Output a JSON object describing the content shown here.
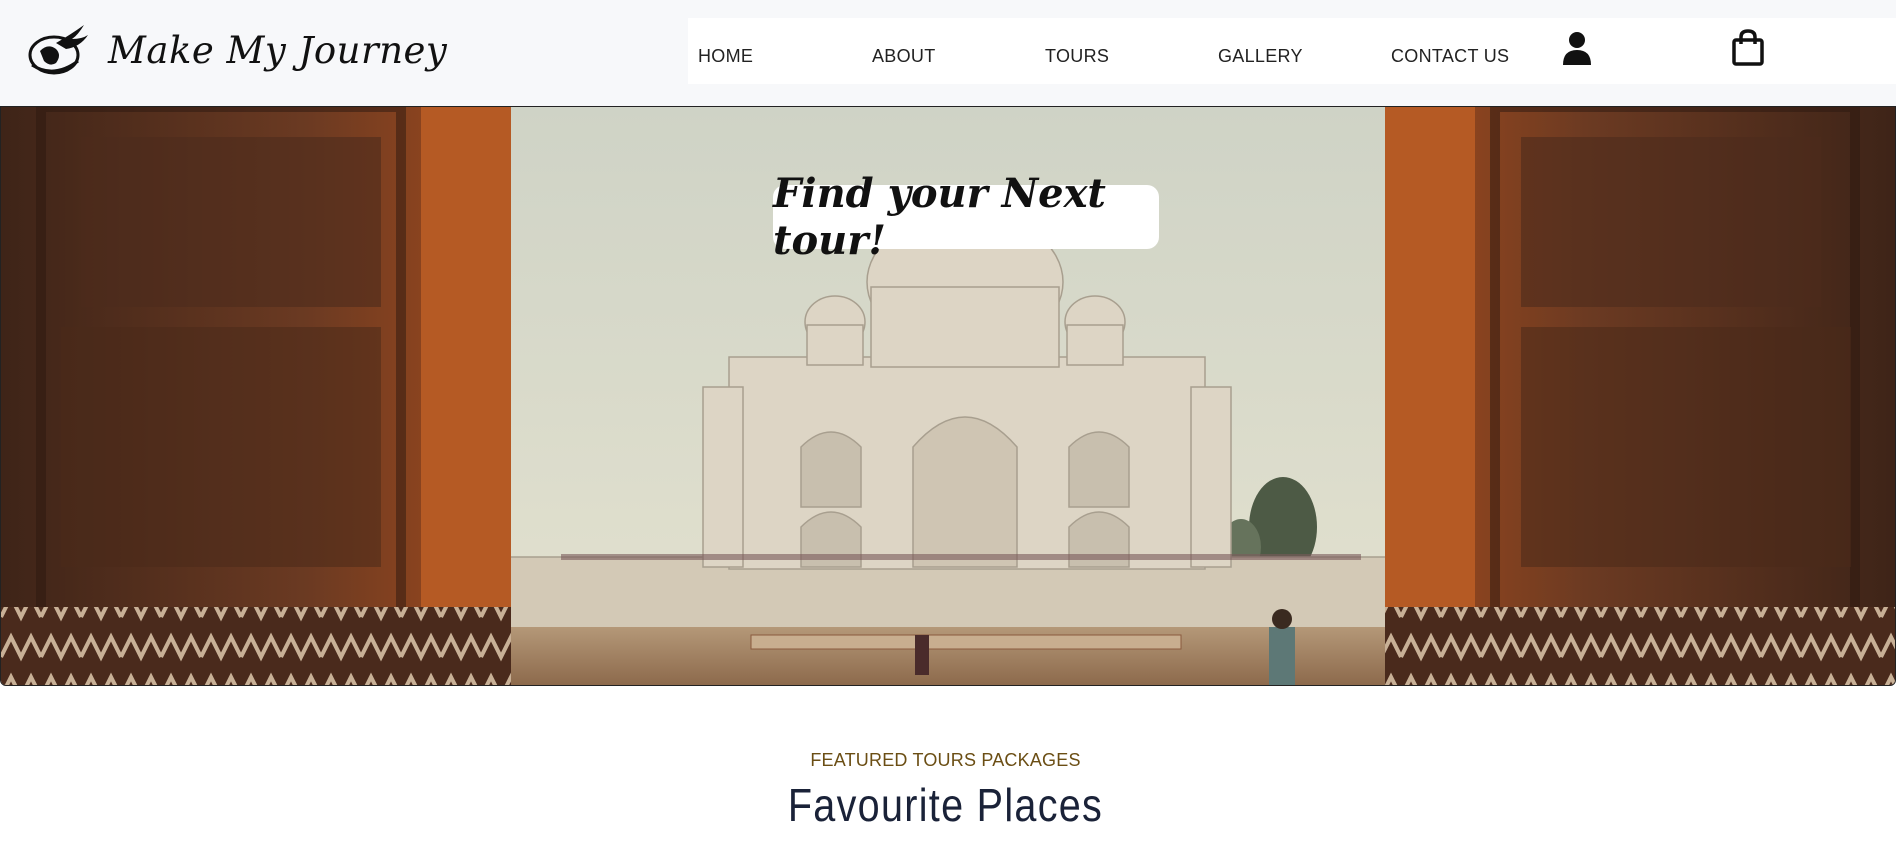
{
  "brand": {
    "name": "Make My Journey",
    "logo_icon": "globe-bird-logo-icon"
  },
  "nav": {
    "items": [
      {
        "label": "HOME"
      },
      {
        "label": "ABOUT"
      },
      {
        "label": "TOURS"
      },
      {
        "label": "GALLERY"
      },
      {
        "label": "CONTACT US"
      }
    ],
    "account_icon": "user-icon",
    "cart_icon": "shopping-bag-icon"
  },
  "hero": {
    "title": "Find your Next tour!",
    "image": "taj-mahal-framed-by-carved-doors"
  },
  "featured": {
    "eyebrow": "FEATURED TOURS PACKAGES",
    "title": "Favourite Places"
  },
  "colors": {
    "header_bg": "#f7f8fa",
    "eyebrow": "#6b4e14",
    "title": "#1a2238"
  }
}
